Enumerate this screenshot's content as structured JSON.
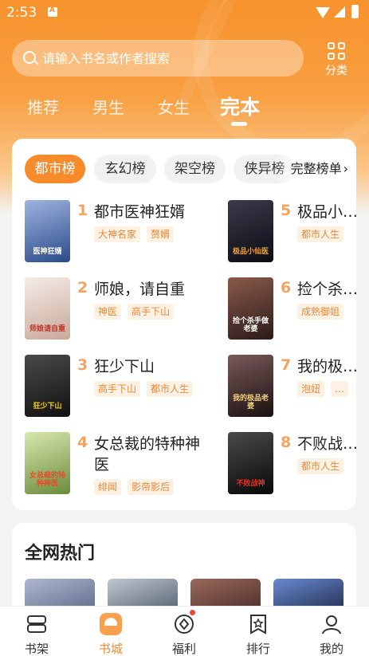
{
  "status_bar": {
    "time": "2:53"
  },
  "search": {
    "placeholder": "请输入书名或作者搜索"
  },
  "category": {
    "label": "分类"
  },
  "tabs": [
    {
      "label": "推荐",
      "active": false
    },
    {
      "label": "男生",
      "active": false
    },
    {
      "label": "女生",
      "active": false
    },
    {
      "label": "完本",
      "active": true
    }
  ],
  "ranking": {
    "chips": [
      {
        "label": "都市榜",
        "active": true
      },
      {
        "label": "玄幻榜",
        "active": false
      },
      {
        "label": "架空榜",
        "active": false
      },
      {
        "label": "侠异榜",
        "active": false
      }
    ],
    "full_rank_label": "完整榜单",
    "books": [
      {
        "rank": "1",
        "title": "都市医神狂婿",
        "tags": [
          "大神名家",
          "赘婿"
        ],
        "cover_text": "医神狂婿",
        "cover_color": "#2a4a8a"
      },
      {
        "rank": "2",
        "title": "师娘，请自重",
        "tags": [
          "神医",
          "高手下山"
        ],
        "cover_text": "师娘请自重",
        "cover_color": "#e9d6cf"
      },
      {
        "rank": "3",
        "title": "狂少下山",
        "tags": [
          "高手下山",
          "都市人生"
        ],
        "cover_text": "狂少下山",
        "cover_color": "#2b2b2b"
      },
      {
        "rank": "4",
        "title": "女总裁的特种神医",
        "tags": [
          "绯闻",
          "影帝影后"
        ],
        "cover_text": "女总裁的特种神医",
        "cover_color": "#6a8a3a"
      },
      {
        "rank": "5",
        "title": "极品小…",
        "tags": [
          "都市人生"
        ],
        "cover_text": "极品小仙医",
        "cover_color": "#1c1c2a"
      },
      {
        "rank": "6",
        "title": "捡个杀…",
        "tags": [
          "成熟御姐"
        ],
        "cover_text": "捡个杀手做老婆",
        "cover_color": "#5a3a3a"
      },
      {
        "rank": "7",
        "title": "我的极…",
        "tags": [
          "泡妞",
          "…"
        ],
        "cover_text": "我的极品老婆",
        "cover_color": "#3a2a2a"
      },
      {
        "rank": "8",
        "title": "不败战…",
        "tags": [
          "都市人生"
        ],
        "cover_text": "不败战神",
        "cover_color": "#1a1a1a"
      }
    ]
  },
  "hot": {
    "title": "全网热门",
    "cover_colors": [
      "#6a7a9a",
      "#4a5a6a",
      "#5a3a3a",
      "#2a3a6a"
    ]
  },
  "bottom_nav": [
    {
      "label": "书架",
      "active": false
    },
    {
      "label": "书城",
      "active": true
    },
    {
      "label": "福利",
      "active": false
    },
    {
      "label": "排行",
      "active": false
    },
    {
      "label": "我的",
      "active": false
    }
  ],
  "colors": {
    "accent": "#f78a2a",
    "tag_bg": "#fdf1e4",
    "tag_text": "#e28a3d",
    "rank_number": "#f5a360"
  }
}
